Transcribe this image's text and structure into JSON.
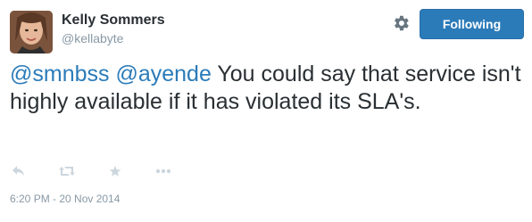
{
  "tweet": {
    "author": {
      "name": "Kelly Sommers",
      "screen_name": "@kellabyte",
      "avatar_icon": "profile-photo"
    },
    "follow_button_label": "Following",
    "settings_icon": "gear-icon",
    "text_mention_1": "@smnbss",
    "text_mention_2": "@ayende",
    "text_body": "You could say that service isn't highly available if it has violated its SLA's.",
    "actions": [
      {
        "name": "reply",
        "icon": "reply-icon"
      },
      {
        "name": "retweet",
        "icon": "retweet-icon"
      },
      {
        "name": "favorite",
        "icon": "star-icon"
      },
      {
        "name": "more",
        "icon": "more-icon"
      }
    ],
    "timestamp": "6:20 PM - 20 Nov 2014"
  },
  "colors": {
    "link": "#2b7bb9",
    "follow_button_bg": "#2b7bb9",
    "muted": "#8899a6",
    "icon": "#ccd6dd",
    "text": "#292f33"
  }
}
